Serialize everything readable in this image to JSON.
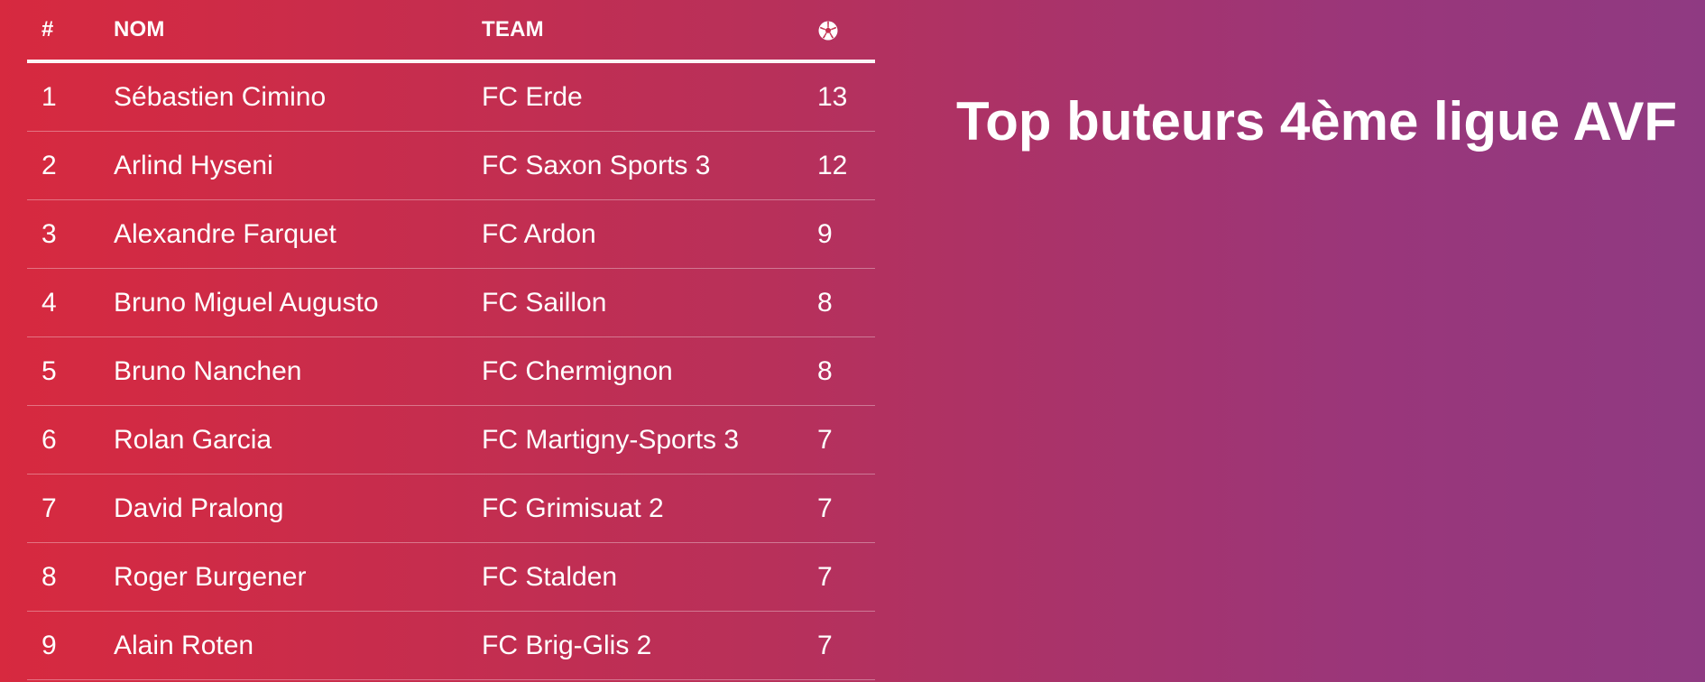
{
  "title": "Top buteurs 4ème ligue AVF",
  "table": {
    "headers": {
      "rank": "#",
      "name": "NOM",
      "team": "TEAM",
      "goals_icon": "soccer-ball-icon"
    },
    "rows": [
      {
        "rank": "1",
        "name": "Sébastien Cimino",
        "team": "FC Erde",
        "goals": "13"
      },
      {
        "rank": "2",
        "name": "Arlind Hyseni",
        "team": "FC Saxon Sports 3",
        "goals": "12"
      },
      {
        "rank": "3",
        "name": "Alexandre Farquet",
        "team": "FC Ardon",
        "goals": "9"
      },
      {
        "rank": "4",
        "name": "Bruno Miguel Augusto",
        "team": "FC Saillon",
        "goals": "8"
      },
      {
        "rank": "5",
        "name": "Bruno Nanchen",
        "team": "FC Chermignon",
        "goals": "8"
      },
      {
        "rank": "6",
        "name": "Rolan Garcia",
        "team": "FC Martigny-Sports 3",
        "goals": "7"
      },
      {
        "rank": "7",
        "name": "David Pralong",
        "team": "FC Grimisuat 2",
        "goals": "7"
      },
      {
        "rank": "8",
        "name": "Roger Burgener",
        "team": "FC Stalden",
        "goals": "7"
      },
      {
        "rank": "9",
        "name": "Alain Roten",
        "team": "FC Brig-Glis 2",
        "goals": "7"
      }
    ]
  },
  "colors": {
    "gradient_start": "#d7293f",
    "gradient_end": "#8f3a82",
    "text": "#ffffff"
  }
}
